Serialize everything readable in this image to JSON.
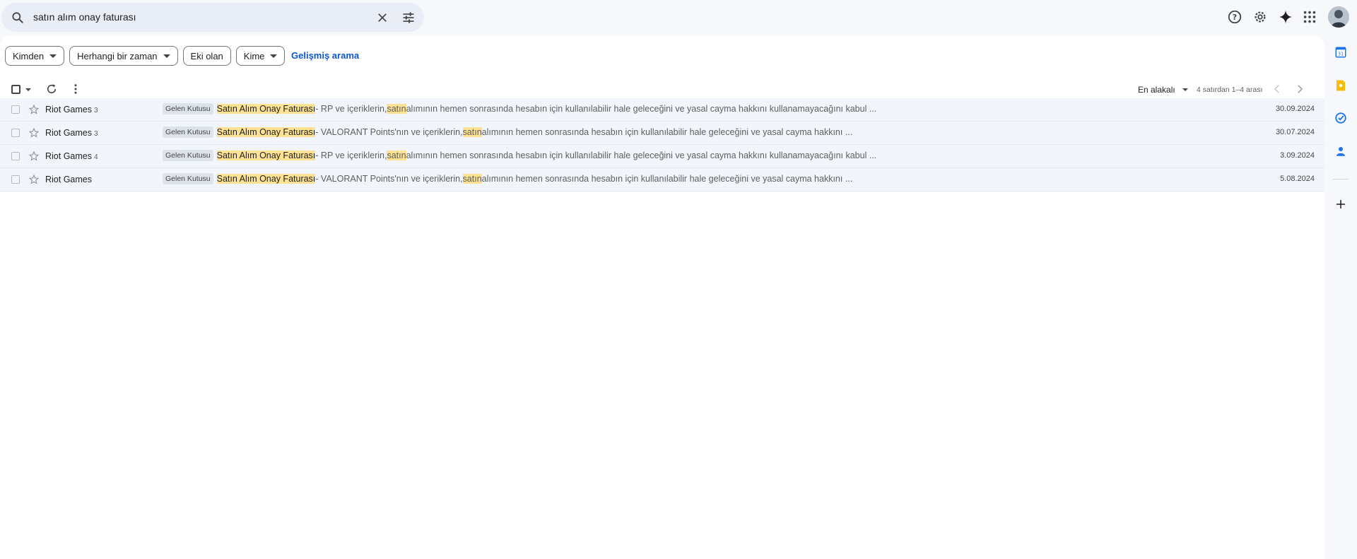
{
  "search": {
    "query": "satın alım onay faturası",
    "icons": [
      "search-icon",
      "clear-icon",
      "tune-icon"
    ]
  },
  "header_icons": [
    "help-icon",
    "settings-icon",
    "gemini-icon",
    "apps-grid-icon",
    "avatar"
  ],
  "filters": {
    "chips": [
      {
        "label": "Kimden",
        "dropdown": true
      },
      {
        "label": "Herhangi bir zaman",
        "dropdown": true
      },
      {
        "label": "Eki olan",
        "dropdown": false
      },
      {
        "label": "Kime",
        "dropdown": true
      }
    ],
    "advanced_label": "Gelişmiş arama"
  },
  "toolbar": {
    "sort_label": "En alakalı",
    "range_label": "4 satırdan 1–4 arası"
  },
  "emails": [
    {
      "sender": "Riot Games",
      "count": "3",
      "label": "Gelen Kutusu",
      "subject": "Satın Alım Onay Faturası",
      "snippet_pre": " - RP ve içeriklerin, ",
      "snippet_hl": "satın",
      "snippet_post": " alımının hemen sonrasında hesabın için kullanılabilir hale geleceğini ve yasal cayma hakkını kullanamayacağını kabul ...",
      "date": "30.09.2024"
    },
    {
      "sender": "Riot Games",
      "count": "3",
      "label": "Gelen Kutusu",
      "subject": "Satın Alım Onay Faturası",
      "snippet_pre": " - VALORANT Points'nın ve içeriklerin, ",
      "snippet_hl": "satın",
      "snippet_post": " alımının hemen sonrasında hesabın için kullanılabilir hale geleceğini ve yasal cayma hakkını ...",
      "date": "30.07.2024"
    },
    {
      "sender": "Riot Games",
      "count": "4",
      "label": "Gelen Kutusu",
      "subject": "Satın Alım Onay Faturası",
      "snippet_pre": " - RP ve içeriklerin, ",
      "snippet_hl": "satın",
      "snippet_post": " alımının hemen sonrasında hesabın için kullanılabilir hale geleceğini ve yasal cayma hakkını kullanamayacağını kabul ...",
      "date": "3.09.2024"
    },
    {
      "sender": "Riot Games",
      "count": "",
      "label": "Gelen Kutusu",
      "subject": "Satın Alım Onay Faturası",
      "snippet_pre": " - VALORANT Points'nın ve içeriklerin, ",
      "snippet_hl": "satın",
      "snippet_post": " alımının hemen sonrasında hesabın için kullanılabilir hale geleceğini ve yasal cayma hakkını ...",
      "date": "5.08.2024"
    }
  ],
  "side_panel": [
    "calendar-icon",
    "keep-icon",
    "tasks-icon",
    "contacts-icon",
    "add-icon"
  ],
  "colors": {
    "highlight": "#fde293",
    "link": "#0b57d0",
    "row_bg": "#f2f6fc",
    "page_bg": "#f6f8fc"
  }
}
